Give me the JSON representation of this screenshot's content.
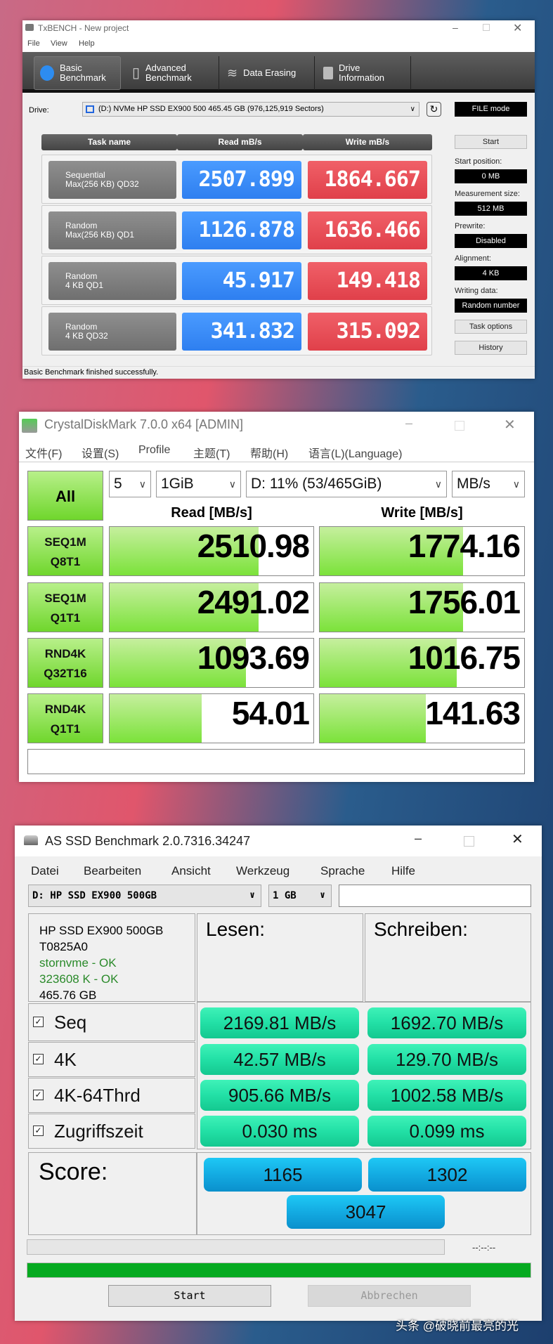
{
  "txbench": {
    "title": "TxBENCH - New project",
    "menu": [
      "File",
      "View",
      "Help"
    ],
    "tabs": [
      {
        "line1": "Basic",
        "line2": "Benchmark"
      },
      {
        "line1": "Advanced",
        "line2": "Benchmark"
      },
      {
        "line1": "Data Erasing",
        "line2": ""
      },
      {
        "line1": "Drive",
        "line2": "Information"
      }
    ],
    "drive_label": "Drive:",
    "drive_value": "(D:) NVMe HP SSD EX900 500  465.45 GB (976,125,919 Sectors)",
    "file_mode": "FILE mode",
    "headers": [
      "Task name",
      "Read mB/s",
      "Write mB/s"
    ],
    "rows": [
      {
        "l1": "Sequential",
        "l2": "Max(256 KB) QD32",
        "read": "2507.899",
        "write": "1864.667"
      },
      {
        "l1": "Random",
        "l2": "Max(256 KB) QD1",
        "read": "1126.878",
        "write": "1636.466"
      },
      {
        "l1": "Random",
        "l2": "4 KB QD1",
        "read": "45.917",
        "write": "149.418"
      },
      {
        "l1": "Random",
        "l2": "4 KB QD32",
        "read": "341.832",
        "write": "315.092"
      }
    ],
    "start": "Start",
    "settings": [
      {
        "label": "Start position:",
        "value": "0 MB"
      },
      {
        "label": "Measurement size:",
        "value": "512 MB"
      },
      {
        "label": "Prewrite:",
        "value": "Disabled"
      },
      {
        "label": "Alignment:",
        "value": "4 KB"
      },
      {
        "label": "Writing data:",
        "value": "Random number"
      }
    ],
    "task_options": "Task options",
    "history": "History",
    "status": "Basic Benchmark finished successfully."
  },
  "cdm": {
    "title": "CrystalDiskMark 7.0.0 x64 [ADMIN]",
    "menu": [
      "文件(F)",
      "设置(S)",
      "Profile",
      "主题(T)",
      "帮助(H)",
      "语言(L)(Language)"
    ],
    "all": "All",
    "count": "5",
    "size": "1GiB",
    "drive": "D: 11% (53/465GiB)",
    "unit": "MB/s",
    "read_header": "Read [MB/s]",
    "write_header": "Write [MB/s]",
    "rows": [
      {
        "l1": "SEQ1M",
        "l2": "Q8T1",
        "read": "2510.98",
        "write": "1774.16",
        "read_fill": 0.73,
        "write_fill": 0.7
      },
      {
        "l1": "SEQ1M",
        "l2": "Q1T1",
        "read": "2491.02",
        "write": "1756.01",
        "read_fill": 0.73,
        "write_fill": 0.7
      },
      {
        "l1": "RND4K",
        "l2": "Q32T16",
        "read": "1093.69",
        "write": "1016.75",
        "read_fill": 0.67,
        "write_fill": 0.67
      },
      {
        "l1": "RND4K",
        "l2": "Q1T1",
        "read": "54.01",
        "write": "141.63",
        "read_fill": 0.45,
        "write_fill": 0.52
      }
    ]
  },
  "asssd": {
    "title": "AS SSD Benchmark 2.0.7316.34247",
    "menu": [
      "Datei",
      "Bearbeiten",
      "Ansicht",
      "Werkzeug",
      "Sprache",
      "Hilfe"
    ],
    "drive": "D: HP SSD EX900 500GB",
    "size": "1 GB",
    "info": {
      "model": "HP SSD EX900 500GB",
      "firmware": "T0825A0",
      "driver": "stornvme - OK",
      "align": "323608 K - OK",
      "capacity": "465.76 GB"
    },
    "read_header": "Lesen:",
    "write_header": "Schreiben:",
    "rows": [
      {
        "label": "Seq",
        "read": "2169.81 MB/s",
        "write": "1692.70 MB/s"
      },
      {
        "label": "4K",
        "read": "42.57 MB/s",
        "write": "129.70 MB/s"
      },
      {
        "label": "4K-64Thrd",
        "read": "905.66 MB/s",
        "write": "1002.58 MB/s"
      },
      {
        "label": "Zugriffszeit",
        "read": "0.030 ms",
        "write": "0.099 ms"
      }
    ],
    "score_label": "Score:",
    "score_read": "1165",
    "score_write": "1302",
    "score_total": "3047",
    "time": "--:--:--",
    "progress": 1.0,
    "start": "Start",
    "cancel": "Abbrechen"
  },
  "watermark": "头条 @破晓前最亮的光",
  "colors": {
    "tx_read": "#2e7ff0",
    "tx_write": "#e0404a",
    "cdm_green": "#7be23a",
    "as_green": "#22e0a6",
    "as_blue": "#12a8e0",
    "progress": "#00aa22"
  }
}
